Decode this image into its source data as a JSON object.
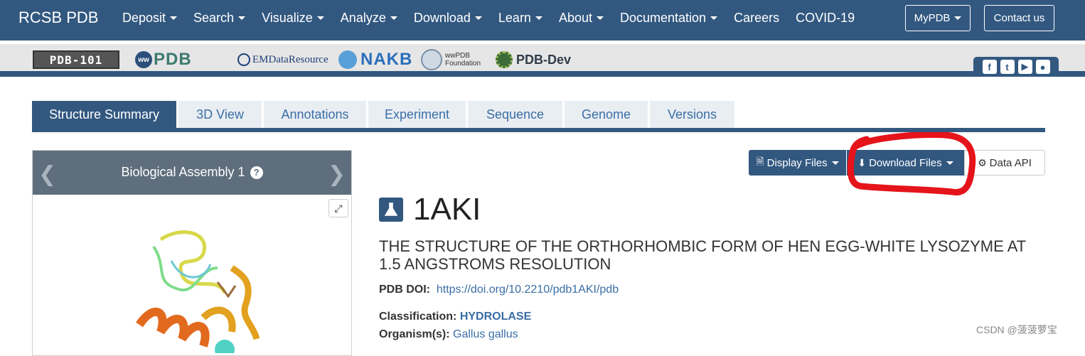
{
  "nav": {
    "brand": "RCSB PDB",
    "items": [
      {
        "label": "Deposit",
        "dropdown": true
      },
      {
        "label": "Search",
        "dropdown": true
      },
      {
        "label": "Visualize",
        "dropdown": true
      },
      {
        "label": "Analyze",
        "dropdown": true
      },
      {
        "label": "Download",
        "dropdown": true
      },
      {
        "label": "Learn",
        "dropdown": true
      },
      {
        "label": "About",
        "dropdown": true
      },
      {
        "label": "Documentation",
        "dropdown": true
      },
      {
        "label": "Careers",
        "dropdown": false
      },
      {
        "label": "COVID-19",
        "dropdown": false
      }
    ],
    "mypdb_label": "MyPDB",
    "contact_label": "Contact us"
  },
  "partners": {
    "pdb101": "PDB-101",
    "wwpdb": "PDB",
    "emdr": "EMDataResource",
    "nakb": "NAKB",
    "wwpdb_foundation": [
      "wwPDB",
      "Foundation"
    ],
    "pdbdev": "PDB-Dev"
  },
  "social_icons": [
    "facebook-icon",
    "twitter-icon",
    "youtube-icon",
    "github-icon"
  ],
  "tabs": [
    {
      "label": "Structure Summary",
      "active": true
    },
    {
      "label": "3D View",
      "active": false
    },
    {
      "label": "Annotations",
      "active": false
    },
    {
      "label": "Experiment",
      "active": false
    },
    {
      "label": "Sequence",
      "active": false
    },
    {
      "label": "Genome",
      "active": false
    },
    {
      "label": "Versions",
      "active": false
    }
  ],
  "assembly_panel": {
    "title": "Biological Assembly 1",
    "help": "?"
  },
  "file_buttons": {
    "display": "Display Files",
    "download": "Download Files",
    "api": "Data API"
  },
  "entry": {
    "id": "1AKI",
    "description": "THE STRUCTURE OF THE ORTHORHOMBIC FORM OF HEN EGG-WHITE LYSOZYME AT 1.5 ANGSTROMS RESOLUTION",
    "doi_label": "PDB DOI:",
    "doi": "https://doi.org/10.2210/pdb1AKI/pdb",
    "classification_label": "Classification:",
    "classification": "HYDROLASE",
    "organism_label": "Organism(s):",
    "organism": "Gallus gallus"
  },
  "watermark": "CSDN @菠菠萝宝",
  "colors": {
    "primary": "#325880",
    "link": "#3a6ea5",
    "annotation": "#e5141b"
  }
}
